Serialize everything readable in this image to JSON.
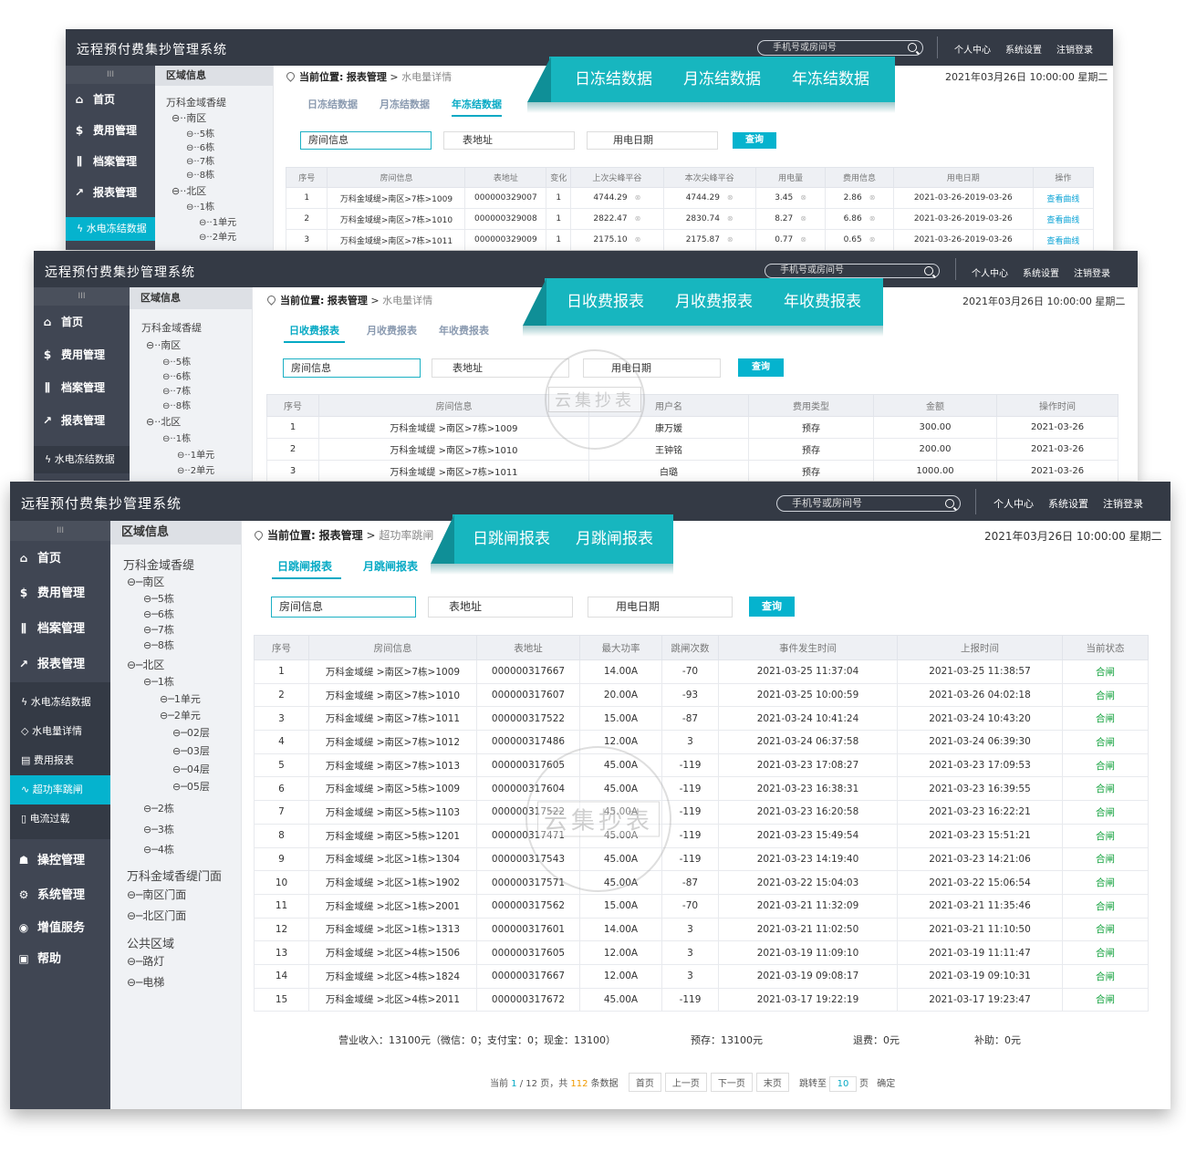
{
  "app_title": "远程预付费集抄管理系统",
  "search_placeholder": "手机号或房间号",
  "topnav": [
    "个人中心",
    "系统设置",
    "注销登录"
  ],
  "datetime": "2021年03月26日   10:00:00   星期二",
  "watermark": "云集抄表",
  "menu": {
    "grip": "III",
    "home": "首页",
    "fee": "费用管理",
    "archive": "档案管理",
    "report": "报表管理",
    "control": "操控管理",
    "system": "系统管理",
    "value_added": "增值服务",
    "help": "帮助"
  },
  "submenu": [
    "水电冻结数据",
    "水电量详情",
    "费用报表",
    "超功率跳闸",
    "电流过载"
  ],
  "tree": {
    "header": "区域信息",
    "root": "万科金域香缇",
    "south": "南区",
    "north": "北区",
    "b5": "5栋",
    "b6": "6栋",
    "b7": "7栋",
    "b8": "8栋",
    "b1": "1栋",
    "b2": "2栋",
    "b3": "3栋",
    "b4": "4栋",
    "u1": "1单元",
    "u2": "2单元",
    "f2": "02层",
    "f3": "03层",
    "f4": "04层",
    "f5": "05层",
    "gate_root": "万科金域香缇门面",
    "south_gate": "南区门面",
    "north_gate": "北区门面",
    "public": "公共区域",
    "streetlight": "路灯",
    "elevator": "电梯"
  },
  "crumb": {
    "label": "当前位置:",
    "section": "报表管理",
    "page1": "水电量详情",
    "page2": "水电量详情",
    "page3": "超功率跳闸"
  },
  "filters": {
    "room": "房间信息",
    "meter": "表地址",
    "date": "用电日期",
    "query": "查询"
  },
  "w1": {
    "banner": [
      "日冻结数据",
      "月冻结数据",
      "年冻结数据"
    ],
    "tabs": [
      "日冻结数据",
      "月冻结数据",
      "年冻结数据"
    ],
    "headers": [
      "序号",
      "房间信息",
      "表地址",
      "变化",
      "上次尖峰平谷",
      "本次尖峰平谷",
      "用电量",
      "费用信息",
      "用电日期",
      "操作"
    ],
    "rows": [
      [
        "1",
        "万科金域缇>南区>7栋>1009",
        "000000329007",
        "1",
        "4744.29",
        "4744.29",
        "3.45",
        "2.86",
        "2021-03-26-2019-03-26",
        "查看曲线"
      ],
      [
        "2",
        "万科金域缇>南区>7栋>1010",
        "000000329008",
        "1",
        "2822.47",
        "2830.74",
        "8.27",
        "6.86",
        "2021-03-26-2019-03-26",
        "查看曲线"
      ],
      [
        "3",
        "万科金域缇>南区>7栋>1011",
        "000000329009",
        "1",
        "2175.10",
        "2175.87",
        "0.77",
        "0.65",
        "2021-03-26-2019-03-26",
        "查看曲线"
      ]
    ],
    "mark": "⊗"
  },
  "w2": {
    "banner": [
      "日收费报表",
      "月收费报表",
      "年收费报表"
    ],
    "tabs": [
      "日收费报表",
      "月收费报表",
      "年收费报表"
    ],
    "headers": [
      "序号",
      "房间信息",
      "用户名",
      "费用类型",
      "金额",
      "操作时间"
    ],
    "rows": [
      [
        "1",
        "万科金域缇 >南区>7栋>1009",
        "康万媛",
        "预存",
        "300.00",
        "2021-03-26"
      ],
      [
        "2",
        "万科金域缇 >南区>7栋>1010",
        "王钟铭",
        "预存",
        "200.00",
        "2021-03-26"
      ],
      [
        "3",
        "万科金域缇 >南区>7栋>1011",
        "白璐",
        "预存",
        "1000.00",
        "2021-03-26"
      ]
    ]
  },
  "w3": {
    "banner": [
      "日跳闸报表",
      "月跳闸报表"
    ],
    "tabs": [
      "日跳闸报表",
      "月跳闸报表"
    ],
    "headers": [
      "序号",
      "房间信息",
      "表地址",
      "最大功率",
      "跳闸次数",
      "事件发生时间",
      "上报时间",
      "当前状态"
    ],
    "rows": [
      [
        "1",
        "万科金域缇 >南区>7栋>1009",
        "000000317667",
        "14.00A",
        "-70",
        "2021-03-25  11:37:04",
        "2021-03-25  11:38:57",
        "合闸"
      ],
      [
        "2",
        "万科金域缇 >南区>7栋>1010",
        "000000317607",
        "20.00A",
        "-93",
        "2021-03-25  10:00:59",
        "2021-03-26  04:02:18",
        "合闸"
      ],
      [
        "3",
        "万科金域缇 >南区>7栋>1011",
        "000000317522",
        "15.00A",
        "-87",
        "2021-03-24  10:41:24",
        "2021-03-24  10:43:20",
        "合闸"
      ],
      [
        "4",
        "万科金域缇 >南区>7栋>1012",
        "000000317486",
        "12.00A",
        "3",
        "2021-03-24  06:37:58",
        "2021-03-24  06:39:30",
        "合闸"
      ],
      [
        "5",
        "万科金域缇 >南区>7栋>1013",
        "000000317605",
        "45.00A",
        "-119",
        "2021-03-23  17:08:27",
        "2021-03-23  17:09:53",
        "合闸"
      ],
      [
        "6",
        "万科金域缇 >南区>5栋>1009",
        "000000317604",
        "45.00A",
        "-119",
        "2021-03-23  16:38:31",
        "2021-03-23  16:39:55",
        "合闸"
      ],
      [
        "7",
        "万科金域缇 >南区>5栋>1103",
        "000000317522",
        "45.00A",
        "-119",
        "2021-03-23  16:20:58",
        "2021-03-23  16:22:21",
        "合闸"
      ],
      [
        "8",
        "万科金域缇 >南区>5栋>1201",
        "000000317471",
        "45.00A",
        "-119",
        "2021-03-23  15:49:54",
        "2021-03-23  15:51:21",
        "合闸"
      ],
      [
        "9",
        "万科金域缇 >北区>1栋>1304",
        "000000317543",
        "45.00A",
        "-119",
        "2021-03-23  14:19:40",
        "2021-03-23  14:21:06",
        "合闸"
      ],
      [
        "10",
        "万科金域缇 >北区>1栋>1902",
        "000000317571",
        "45.00A",
        "-87",
        "2021-03-22  15:04:03",
        "2021-03-22  15:06:54",
        "合闸"
      ],
      [
        "11",
        "万科金域缇 >北区>1栋>2001",
        "000000317562",
        "15.00A",
        "-70",
        "2021-03-21  11:32:09",
        "2021-03-21  11:35:46",
        "合闸"
      ],
      [
        "12",
        "万科金域缇 >北区>1栋>1313",
        "000000317601",
        "14.00A",
        "3",
        "2021-03-21  11:02:50",
        "2021-03-21  11:10:50",
        "合闸"
      ],
      [
        "13",
        "万科金域缇 >北区>4栋>1506",
        "000000317605",
        "12.00A",
        "3",
        "2021-03-19  11:09:10",
        "2021-03-19  11:11:47",
        "合闸"
      ],
      [
        "14",
        "万科金域缇 >北区>4栋>1824",
        "000000317667",
        "12.00A",
        "3",
        "2021-03-19  09:08:17",
        "2021-03-19  09:10:31",
        "合闸"
      ],
      [
        "15",
        "万科金域缇 >北区>4栋>2011",
        "000000317672",
        "45.00A",
        "-119",
        "2021-03-17  19:22:19",
        "2021-03-17  19:23:47",
        "合闸"
      ]
    ],
    "summary": {
      "revenue": "营业收入：13100元（微信：0；支付宝：0；现金：13100）",
      "prepaid": "预存：13100元",
      "refund": "退费：0元",
      "subsidy": "补助：0元"
    },
    "pager": {
      "cur_label": "当前",
      "cur": "1",
      "total_pages": "/ 12 页，共",
      "count": "112",
      "count_suffix": "条数据",
      "first": "首页",
      "prev": "上一页",
      "next": "下一页",
      "last": "末页",
      "jump": "跳转至",
      "page_input": "10",
      "page_unit": "页",
      "confirm": "确定"
    }
  }
}
